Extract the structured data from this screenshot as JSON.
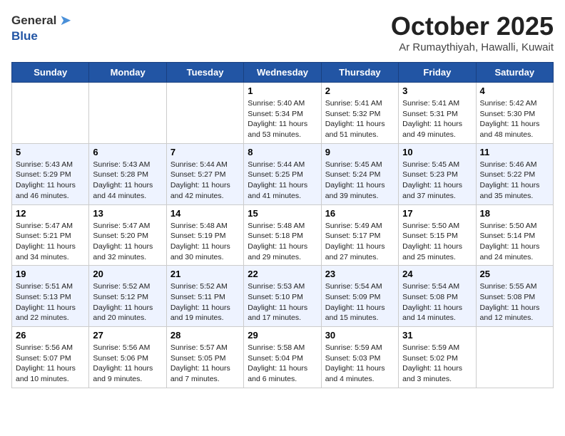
{
  "header": {
    "logo_general": "General",
    "logo_blue": "Blue",
    "month": "October 2025",
    "location": "Ar Rumaythiyah, Hawalli, Kuwait"
  },
  "weekdays": [
    "Sunday",
    "Monday",
    "Tuesday",
    "Wednesday",
    "Thursday",
    "Friday",
    "Saturday"
  ],
  "weeks": [
    [
      {
        "day": "",
        "info": ""
      },
      {
        "day": "",
        "info": ""
      },
      {
        "day": "",
        "info": ""
      },
      {
        "day": "1",
        "info": "Sunrise: 5:40 AM\nSunset: 5:34 PM\nDaylight: 11 hours\nand 53 minutes."
      },
      {
        "day": "2",
        "info": "Sunrise: 5:41 AM\nSunset: 5:32 PM\nDaylight: 11 hours\nand 51 minutes."
      },
      {
        "day": "3",
        "info": "Sunrise: 5:41 AM\nSunset: 5:31 PM\nDaylight: 11 hours\nand 49 minutes."
      },
      {
        "day": "4",
        "info": "Sunrise: 5:42 AM\nSunset: 5:30 PM\nDaylight: 11 hours\nand 48 minutes."
      }
    ],
    [
      {
        "day": "5",
        "info": "Sunrise: 5:43 AM\nSunset: 5:29 PM\nDaylight: 11 hours\nand 46 minutes."
      },
      {
        "day": "6",
        "info": "Sunrise: 5:43 AM\nSunset: 5:28 PM\nDaylight: 11 hours\nand 44 minutes."
      },
      {
        "day": "7",
        "info": "Sunrise: 5:44 AM\nSunset: 5:27 PM\nDaylight: 11 hours\nand 42 minutes."
      },
      {
        "day": "8",
        "info": "Sunrise: 5:44 AM\nSunset: 5:25 PM\nDaylight: 11 hours\nand 41 minutes."
      },
      {
        "day": "9",
        "info": "Sunrise: 5:45 AM\nSunset: 5:24 PM\nDaylight: 11 hours\nand 39 minutes."
      },
      {
        "day": "10",
        "info": "Sunrise: 5:45 AM\nSunset: 5:23 PM\nDaylight: 11 hours\nand 37 minutes."
      },
      {
        "day": "11",
        "info": "Sunrise: 5:46 AM\nSunset: 5:22 PM\nDaylight: 11 hours\nand 35 minutes."
      }
    ],
    [
      {
        "day": "12",
        "info": "Sunrise: 5:47 AM\nSunset: 5:21 PM\nDaylight: 11 hours\nand 34 minutes."
      },
      {
        "day": "13",
        "info": "Sunrise: 5:47 AM\nSunset: 5:20 PM\nDaylight: 11 hours\nand 32 minutes."
      },
      {
        "day": "14",
        "info": "Sunrise: 5:48 AM\nSunset: 5:19 PM\nDaylight: 11 hours\nand 30 minutes."
      },
      {
        "day": "15",
        "info": "Sunrise: 5:48 AM\nSunset: 5:18 PM\nDaylight: 11 hours\nand 29 minutes."
      },
      {
        "day": "16",
        "info": "Sunrise: 5:49 AM\nSunset: 5:17 PM\nDaylight: 11 hours\nand 27 minutes."
      },
      {
        "day": "17",
        "info": "Sunrise: 5:50 AM\nSunset: 5:15 PM\nDaylight: 11 hours\nand 25 minutes."
      },
      {
        "day": "18",
        "info": "Sunrise: 5:50 AM\nSunset: 5:14 PM\nDaylight: 11 hours\nand 24 minutes."
      }
    ],
    [
      {
        "day": "19",
        "info": "Sunrise: 5:51 AM\nSunset: 5:13 PM\nDaylight: 11 hours\nand 22 minutes."
      },
      {
        "day": "20",
        "info": "Sunrise: 5:52 AM\nSunset: 5:12 PM\nDaylight: 11 hours\nand 20 minutes."
      },
      {
        "day": "21",
        "info": "Sunrise: 5:52 AM\nSunset: 5:11 PM\nDaylight: 11 hours\nand 19 minutes."
      },
      {
        "day": "22",
        "info": "Sunrise: 5:53 AM\nSunset: 5:10 PM\nDaylight: 11 hours\nand 17 minutes."
      },
      {
        "day": "23",
        "info": "Sunrise: 5:54 AM\nSunset: 5:09 PM\nDaylight: 11 hours\nand 15 minutes."
      },
      {
        "day": "24",
        "info": "Sunrise: 5:54 AM\nSunset: 5:08 PM\nDaylight: 11 hours\nand 14 minutes."
      },
      {
        "day": "25",
        "info": "Sunrise: 5:55 AM\nSunset: 5:08 PM\nDaylight: 11 hours\nand 12 minutes."
      }
    ],
    [
      {
        "day": "26",
        "info": "Sunrise: 5:56 AM\nSunset: 5:07 PM\nDaylight: 11 hours\nand 10 minutes."
      },
      {
        "day": "27",
        "info": "Sunrise: 5:56 AM\nSunset: 5:06 PM\nDaylight: 11 hours\nand 9 minutes."
      },
      {
        "day": "28",
        "info": "Sunrise: 5:57 AM\nSunset: 5:05 PM\nDaylight: 11 hours\nand 7 minutes."
      },
      {
        "day": "29",
        "info": "Sunrise: 5:58 AM\nSunset: 5:04 PM\nDaylight: 11 hours\nand 6 minutes."
      },
      {
        "day": "30",
        "info": "Sunrise: 5:59 AM\nSunset: 5:03 PM\nDaylight: 11 hours\nand 4 minutes."
      },
      {
        "day": "31",
        "info": "Sunrise: 5:59 AM\nSunset: 5:02 PM\nDaylight: 11 hours\nand 3 minutes."
      },
      {
        "day": "",
        "info": ""
      }
    ]
  ]
}
